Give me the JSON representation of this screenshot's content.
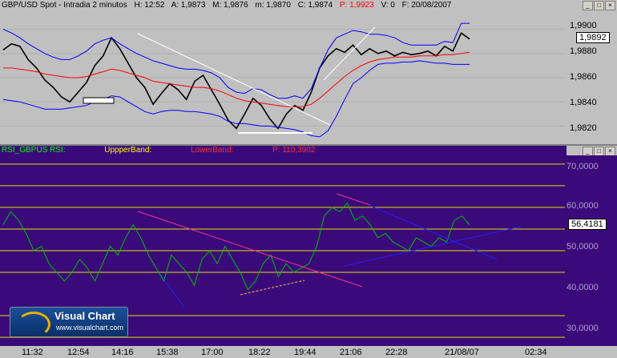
{
  "top_pane": {
    "header": {
      "symbol": "GBP/USD Spot - Intradia 2 minutos",
      "high": "H: 12:52",
      "ask": "A: 1,9873",
      "max": "M: 1,9876",
      "min": "m: 1,9870",
      "close": "C: 1,9874",
      "p": "P: 1,9923",
      "v": "V: 0",
      "date": "F: 20/08/2007",
      "p_color": "#ff0000"
    },
    "buttons": [
      "_",
      "□",
      "×"
    ],
    "current_value": "1,9892"
  },
  "bottom_pane": {
    "header": {
      "title": "RSI_GBPUS RSI:",
      "upper": "UppperBand:",
      "lower": "LowerBand:",
      "p": "P: 110,3902"
    },
    "buttons": [
      "_",
      "□",
      "×"
    ],
    "current_value": "56,4181"
  },
  "time_labels": [
    "11:32",
    "12:54",
    "14:16",
    "15:38",
    "17:00",
    "18:22",
    "19:44",
    "21:06",
    "22:28",
    "21/08/07",
    "02:34"
  ],
  "logo": {
    "title": "Visual Chart",
    "url": "www.visualchart.com"
  },
  "colors": {
    "price": "#000000",
    "bollinger": "#0000ff",
    "moving_avg": "#ff0000",
    "rsi": "#00c000",
    "levels": "#e0e000",
    "rsi_bg": "#3a0a7a",
    "price_bg": "#c0c0c0"
  },
  "chart_data": [
    {
      "type": "line",
      "title": "GBP/USD Spot - Intradia 2 minutos",
      "ylim": [
        1.9805,
        1.9915
      ],
      "yticks": [
        "1,9900",
        "1,9880",
        "1,9860",
        "1,9840",
        "1,9820"
      ],
      "series": [
        {
          "name": "price",
          "values": [
            1.9883,
            1.9888,
            1.9886,
            1.9875,
            1.9868,
            1.9858,
            1.9852,
            1.9844,
            1.984,
            1.9848,
            1.9856,
            1.987,
            1.9878,
            1.9893,
            1.9884,
            1.9872,
            1.986,
            1.9852,
            1.9838,
            1.9847,
            1.9855,
            1.985,
            1.9842,
            1.9857,
            1.9862,
            1.985,
            1.9838,
            1.9825,
            1.9818,
            1.983,
            1.9843,
            1.9837,
            1.9826,
            1.9818,
            1.983,
            1.9837,
            1.9833,
            1.9848,
            1.9868,
            1.9878,
            1.9884,
            1.9881,
            1.9887,
            1.9879,
            1.9884,
            1.988,
            1.9882,
            1.9878,
            1.9881,
            1.9879,
            1.988,
            1.9882,
            1.9878,
            1.9886,
            1.9882,
            1.9897,
            1.9892
          ]
        },
        {
          "name": "bollinger_upper",
          "values": [
            1.99,
            1.9897,
            1.9893,
            1.9888,
            1.9884,
            1.988,
            1.9877,
            1.9875,
            1.9875,
            1.9878,
            1.9882,
            1.9888,
            1.9891,
            1.9893,
            1.9888,
            1.9884,
            1.988,
            1.9877,
            1.9874,
            1.9872,
            1.987,
            1.9868,
            1.9867,
            1.9867,
            1.9866,
            1.9864,
            1.986,
            1.9852,
            1.9848,
            1.9847,
            1.9851,
            1.985,
            1.9846,
            1.9843,
            1.9843,
            1.9845,
            1.9843,
            1.9851,
            1.9868,
            1.9883,
            1.9893,
            1.9896,
            1.9899,
            1.9898,
            1.9896,
            1.9896,
            1.9895,
            1.9893,
            1.9889,
            1.9887,
            1.9887,
            1.9887,
            1.9887,
            1.989,
            1.9889,
            1.9905,
            1.9905
          ]
        },
        {
          "name": "bollinger_lower",
          "values": [
            1.9842,
            1.9841,
            1.984,
            1.9838,
            1.9836,
            1.9834,
            1.9834,
            1.9834,
            1.9835,
            1.9836,
            1.9837,
            1.984,
            1.9842,
            1.9845,
            1.9844,
            1.984,
            1.9836,
            1.9832,
            1.983,
            1.9832,
            1.9833,
            1.9833,
            1.9832,
            1.9832,
            1.9831,
            1.983,
            1.9828,
            1.9824,
            1.9822,
            1.9822,
            1.9821,
            1.982,
            1.982,
            1.9819,
            1.9818,
            1.9817,
            1.9815,
            1.9812,
            1.9811,
            1.9816,
            1.9828,
            1.9842,
            1.9855,
            1.986,
            1.9866,
            1.9871,
            1.9872,
            1.9872,
            1.9873,
            1.9873,
            1.9874,
            1.9873,
            1.9872,
            1.9872,
            1.9871,
            1.9871,
            1.9871
          ]
        },
        {
          "name": "moving_average",
          "values": [
            1.9868,
            1.9868,
            1.9867,
            1.9866,
            1.9865,
            1.9863,
            1.9862,
            1.9861,
            1.986,
            1.986,
            1.9861,
            1.9863,
            1.9865,
            1.9867,
            1.9866,
            1.9864,
            1.9862,
            1.986,
            1.9857,
            1.9856,
            1.9855,
            1.9854,
            1.9853,
            1.9852,
            1.9852,
            1.9851,
            1.9849,
            1.9846,
            1.9843,
            1.9841,
            1.984,
            1.9839,
            1.9838,
            1.9837,
            1.9836,
            1.9836,
            1.9836,
            1.9838,
            1.9843,
            1.9849,
            1.9855,
            1.9861,
            1.9866,
            1.987,
            1.9873,
            1.9875,
            1.9876,
            1.9877,
            1.9877,
            1.9877,
            1.9878,
            1.9878,
            1.9878,
            1.9879,
            1.9879,
            1.988,
            1.9881
          ]
        }
      ]
    },
    {
      "type": "line",
      "title": "RSI_GBPUS",
      "ylim": [
        28,
        72
      ],
      "yticks": [
        "70,0000",
        "60,0000",
        "50,0000",
        "40,0000",
        "30,0000"
      ],
      "levels": [
        70,
        65,
        60,
        55,
        50,
        45,
        35,
        30
      ],
      "series": [
        {
          "name": "RSI",
          "values": [
            56,
            59,
            57,
            54,
            50,
            51,
            47,
            45,
            43,
            45,
            48,
            46,
            43,
            47,
            51,
            49,
            53,
            56,
            53,
            49,
            46,
            43,
            49,
            47,
            45,
            42,
            48,
            50,
            47,
            51,
            48,
            45,
            41,
            43,
            47,
            49,
            44,
            47,
            45,
            46,
            47,
            51,
            58,
            60,
            59,
            61,
            57,
            58,
            56,
            53,
            54,
            52,
            51,
            50,
            53,
            52,
            51,
            53,
            52,
            57,
            58,
            56
          ]
        }
      ]
    }
  ]
}
